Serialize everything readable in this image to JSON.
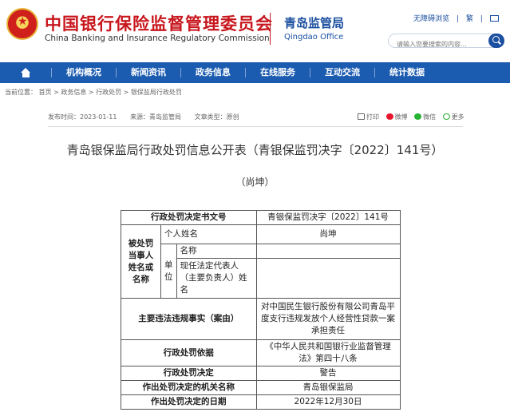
{
  "header": {
    "site_name_cn": "中国银行保险监督管理委员会",
    "site_name_en": "China Banking and Insurance Regulatory Commission",
    "branch_cn": "青岛监管局",
    "branch_en": "Qingdao Office",
    "accessibility_link": "无障碍浏览",
    "traditional_link": "繁",
    "search_placeholder": "请输入您要搜索的内容..."
  },
  "nav": {
    "items": [
      "机构概况",
      "新闻资讯",
      "政务信息",
      "在线服务",
      "互动交流",
      "统计数据"
    ]
  },
  "breadcrumb": "当前位置：  首页  >  政务信息  >  行政处罚  >  银保监局行政处罚",
  "meta": {
    "publish_time": "发布时间：2023-01-11",
    "source": "来源：青岛监管局",
    "doc_type": "文章类型：原创",
    "print": "打印",
    "weibo": "微博",
    "wechat": "微信",
    "more": "更多"
  },
  "article": {
    "title": "青岛银保监局行政处罚信息公开表（青银保监罚决字〔2022〕141号）",
    "subtitle": "（尚坤）"
  },
  "table": {
    "row1_label": "行政处罚决定书文号",
    "row1_value": "青银保监罚决字〔2022〕141号",
    "party_label": "被处罚当事人姓名或名称",
    "personal_name_label": "个人姓名",
    "personal_name_value": "尚坤",
    "unit_label": "单位",
    "unit_name_label": "名称",
    "unit_rep_label": "现任法定代表人（主要负责人）姓名",
    "facts_label": "主要违法违规事实（案由）",
    "facts_value": "对中国民生银行股份有限公司青岛平度支行违规发放个人经营性贷款一案承担责任",
    "basis_label": "行政处罚依据",
    "basis_value": "《中华人民共和国银行业监督管理法》第四十八条",
    "decision_label": "行政处罚决定",
    "decision_value": "警告",
    "org_label": "作出处罚决定的机关名称",
    "org_value": "青岛银保监局",
    "date_label": "作出处罚决定的日期",
    "date_value": "2022年12月30日"
  }
}
